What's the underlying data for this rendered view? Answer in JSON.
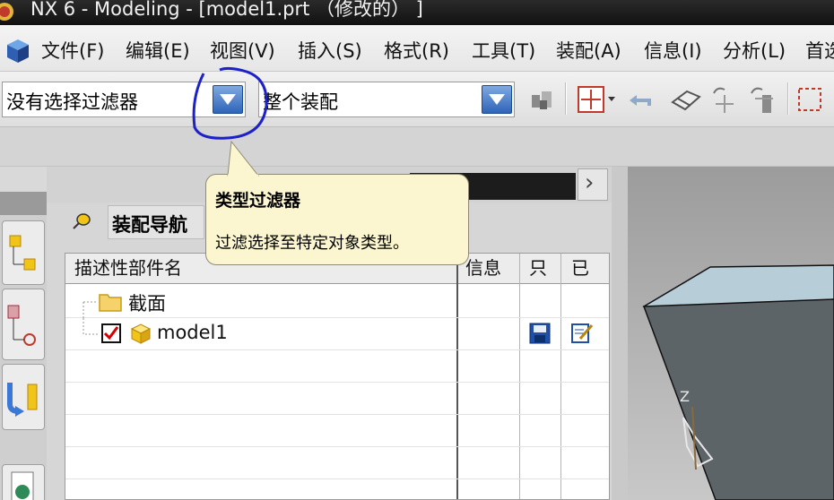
{
  "window": {
    "title": "NX 6 - Modeling - [model1.prt  （修改的） ]"
  },
  "menubar": {
    "items": [
      {
        "label": "文件(F)"
      },
      {
        "label": "编辑(E)"
      },
      {
        "label": "视图(V)"
      },
      {
        "label": "插入(S)"
      },
      {
        "label": "格式(R)"
      },
      {
        "label": "工具(T)"
      },
      {
        "label": "装配(A)"
      },
      {
        "label": "信息(I)"
      },
      {
        "label": "分析(L)"
      },
      {
        "label": "首选"
      }
    ]
  },
  "toolbar": {
    "type_filter": {
      "value": "没有选择过滤器"
    },
    "scope_filter": {
      "value": "整个装配"
    }
  },
  "tooltip": {
    "title": "类型过滤器",
    "text": "过滤选择至特定对象类型。"
  },
  "navigator": {
    "title": "装配导航",
    "columns": {
      "name": "描述性部件名",
      "info": "信息",
      "readonly": "只",
      "modified": "已"
    },
    "rows": [
      {
        "name": "截面",
        "icon": "folder-icon"
      },
      {
        "name": "model1",
        "icon": "part-icon",
        "checked": true,
        "readonly_icon": "save-disk-icon",
        "modified_icon": "edit-note-icon"
      }
    ]
  },
  "viewport": {
    "axis_label": "Z"
  },
  "colors": {
    "titlebar": "#151515",
    "tooltip_bg": "#fbf6cf",
    "annotation": "#1c22c8",
    "combo_arrow": "#2f64b8"
  }
}
